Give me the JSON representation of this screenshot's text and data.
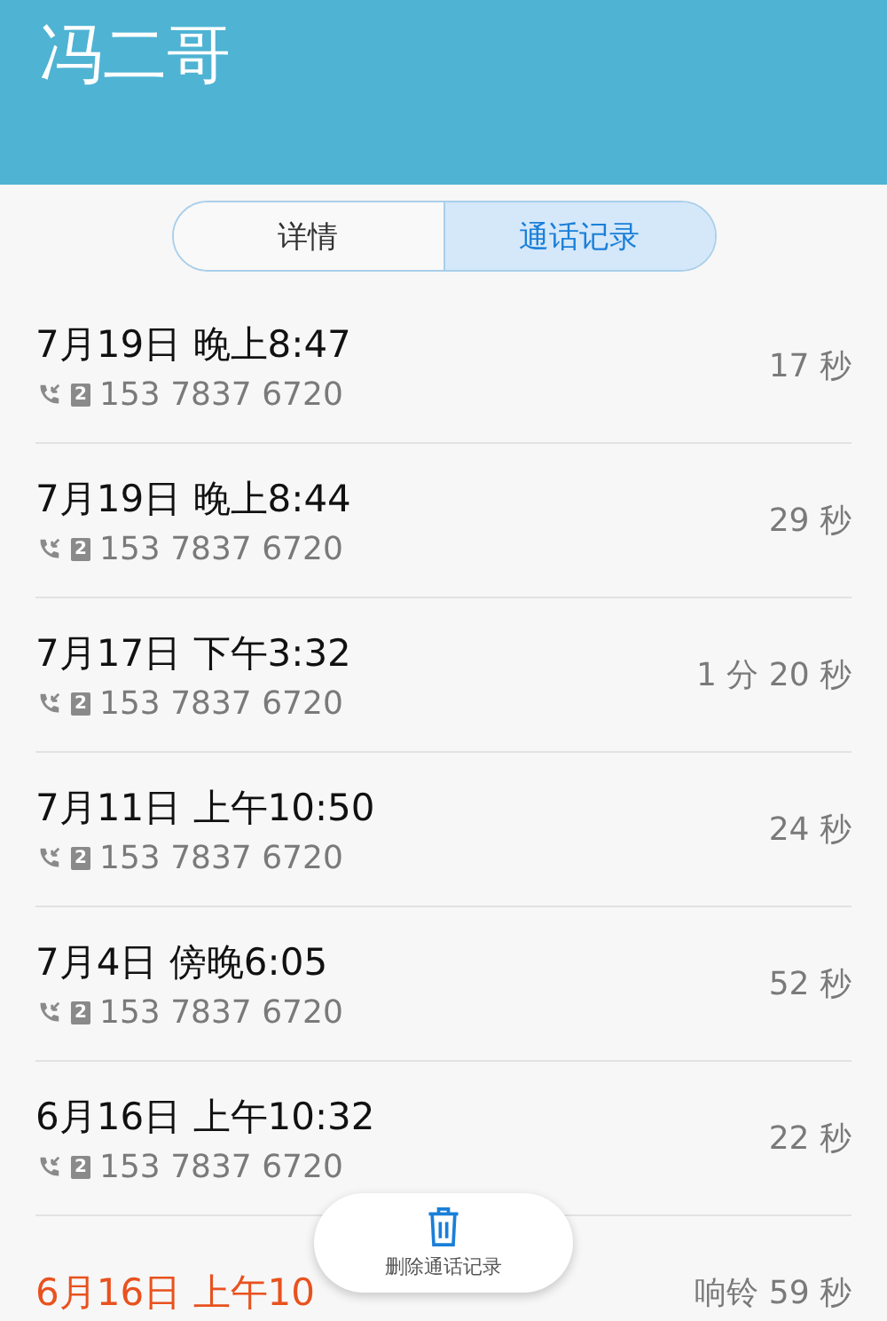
{
  "header": {
    "title": "冯二哥"
  },
  "tabs": [
    {
      "label": "详情",
      "selected": false
    },
    {
      "label": "通话记录",
      "selected": true
    }
  ],
  "calls": [
    {
      "kind": "answered",
      "time": "7月19日 晚上8:47",
      "sim": "2",
      "number": "153 7837 6720",
      "duration": "17 秒"
    },
    {
      "kind": "answered",
      "time": "7月19日 晚上8:44",
      "sim": "2",
      "number": "153 7837 6720",
      "duration": "29 秒"
    },
    {
      "kind": "answered",
      "time": "7月17日 下午3:32",
      "sim": "2",
      "number": "153 7837 6720",
      "duration": "1 分 20 秒"
    },
    {
      "kind": "answered",
      "time": "7月11日 上午10:50",
      "sim": "2",
      "number": "153 7837 6720",
      "duration": "24 秒"
    },
    {
      "kind": "answered",
      "time": "7月4日 傍晚6:05",
      "sim": "2",
      "number": "153 7837 6720",
      "duration": "52 秒"
    },
    {
      "kind": "answered",
      "time": "6月16日 上午10:32",
      "sim": "2",
      "number": "153 7837 6720",
      "duration": "22 秒"
    },
    {
      "kind": "missed",
      "time": "6月16日 上午10",
      "duration": "响铃 59 秒"
    }
  ],
  "delete_button": {
    "label": "删除通话记录"
  }
}
